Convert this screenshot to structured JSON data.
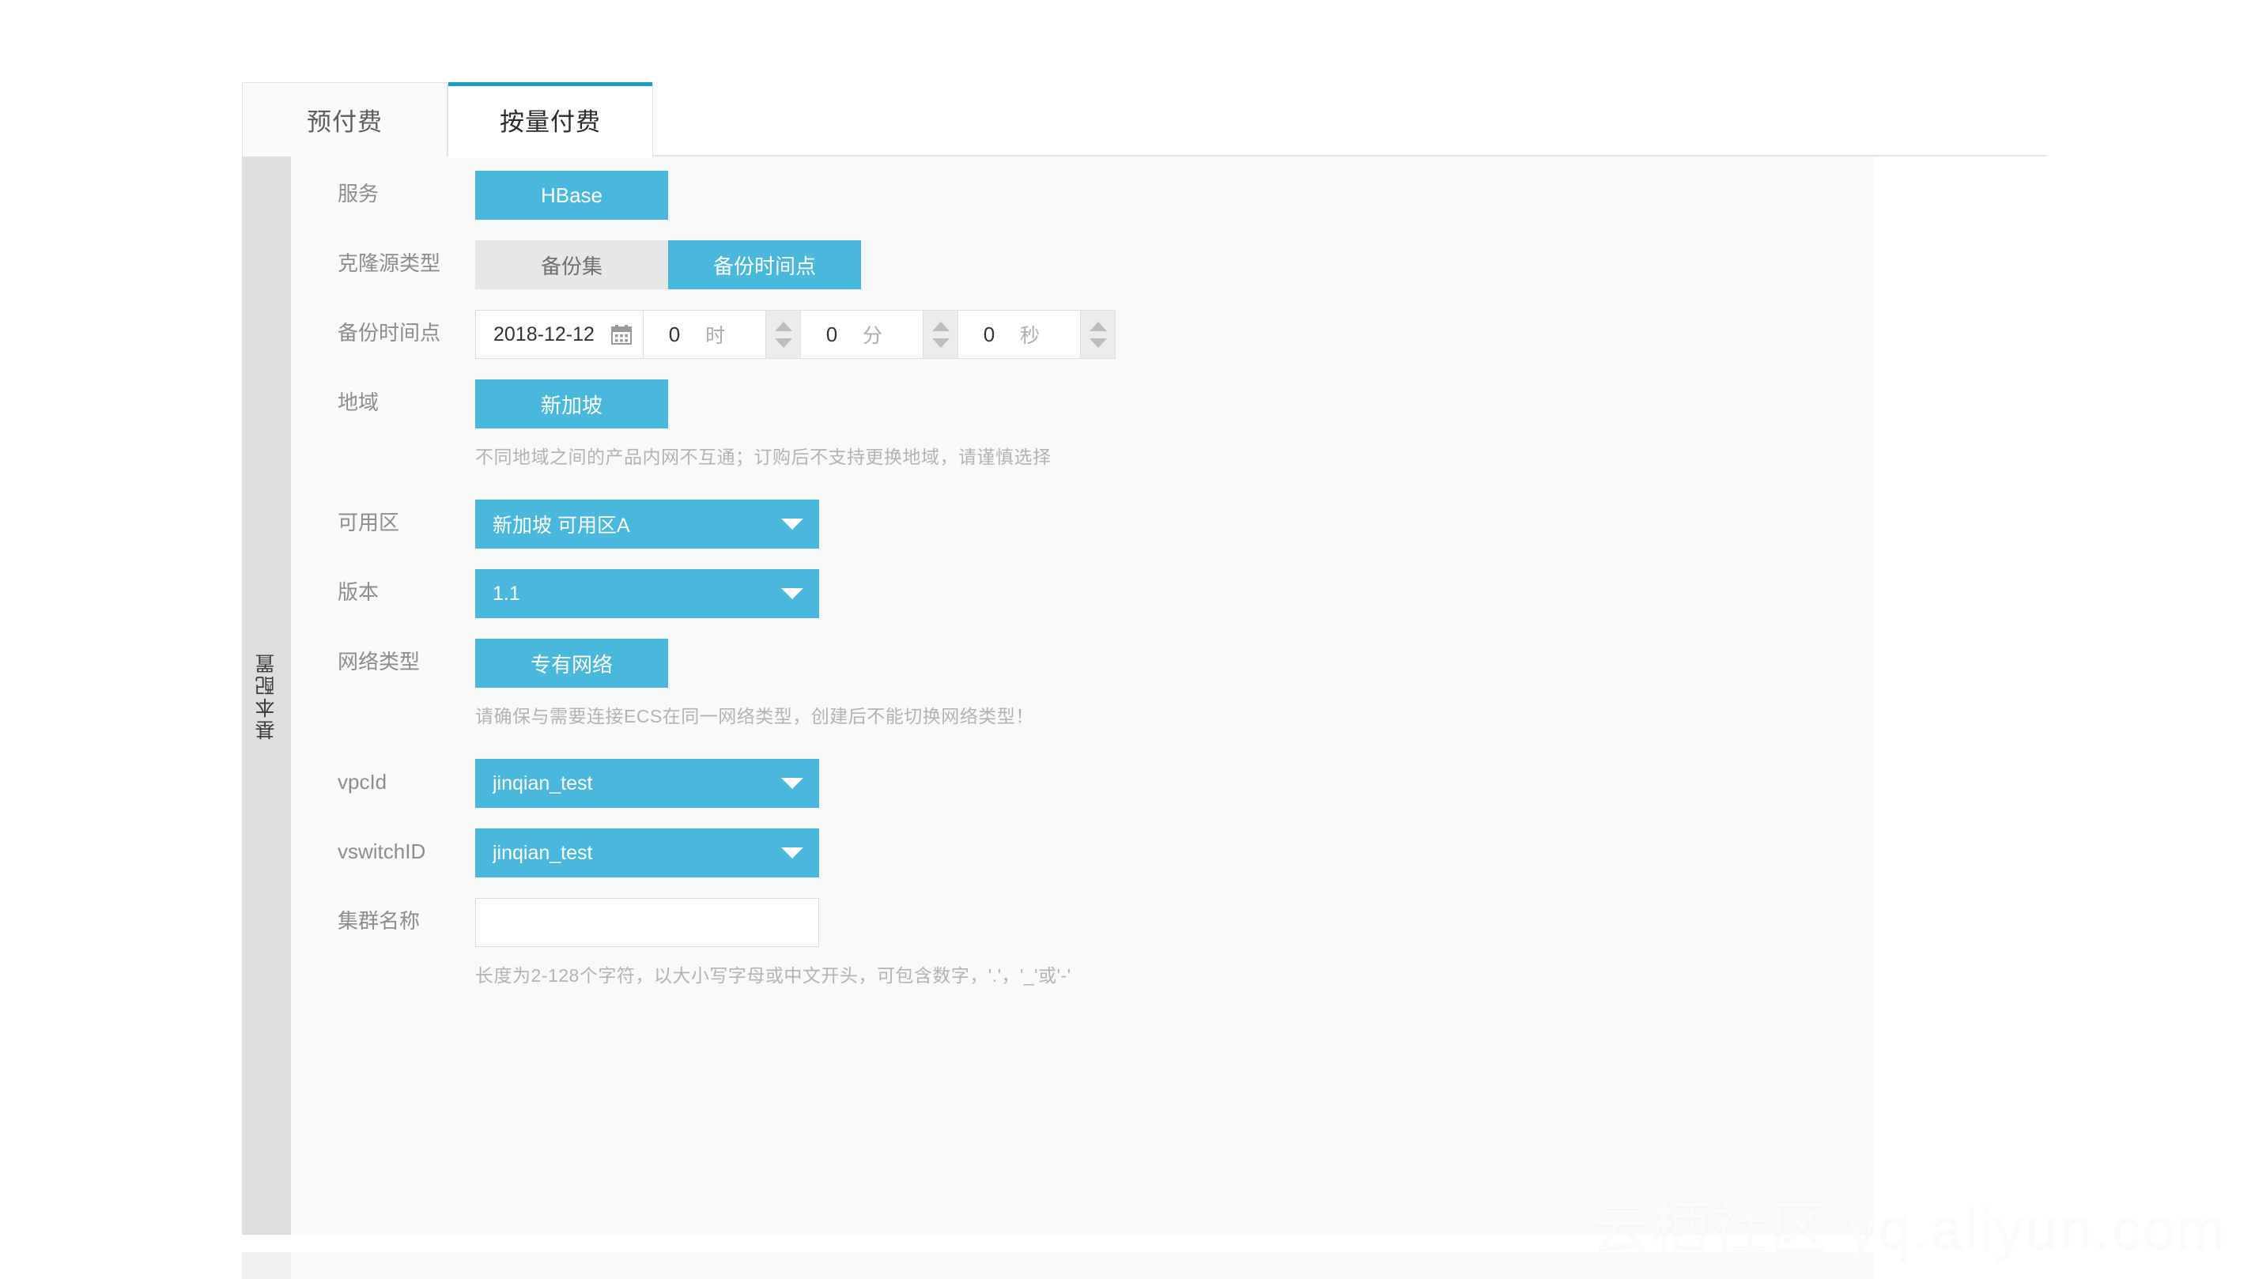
{
  "tabs": [
    {
      "label": "预付费",
      "active": false
    },
    {
      "label": "按量付费",
      "active": true
    }
  ],
  "section": {
    "rail_label": "基本配置"
  },
  "form": {
    "service": {
      "label": "服务",
      "value": "HBase"
    },
    "clone_source_type": {
      "label": "克隆源类型",
      "options": [
        {
          "label": "备份集",
          "selected": false
        },
        {
          "label": "备份时间点",
          "selected": true
        }
      ]
    },
    "backup_time": {
      "label": "备份时间点",
      "date": "2018-12-12",
      "hour": {
        "value": "0",
        "unit": "时"
      },
      "minute": {
        "value": "0",
        "unit": "分"
      },
      "second": {
        "value": "0",
        "unit": "秒"
      },
      "calendar_icon": "calendar-icon"
    },
    "region": {
      "label": "地域",
      "value": "新加坡",
      "hint": "不同地域之间的产品内网不互通；订购后不支持更换地域，请谨慎选择"
    },
    "zone": {
      "label": "可用区",
      "value": "新加坡 可用区A"
    },
    "version": {
      "label": "版本",
      "value": "1.1"
    },
    "network_type": {
      "label": "网络类型",
      "value": "专有网络",
      "hint": "请确保与需要连接ECS在同一网络类型，创建后不能切换网络类型！"
    },
    "vpc_id": {
      "label": "vpcId",
      "value": "jinqian_test"
    },
    "vswitch_id": {
      "label": "vswitchID",
      "value": "jinqian_test"
    },
    "cluster_name": {
      "label": "集群名称",
      "value": "",
      "placeholder": "",
      "hint": "长度为2-128个字符，以大小写字母或中文开头，可包含数字，'.'，'_'或'-'"
    }
  },
  "watermark": "云栖社区 yq.aliyun.com",
  "colors": {
    "accent": "#4ab8dc",
    "tab_active_bar": "#1c9cc4",
    "panel_bg": "#f9f9f9",
    "rail_bg": "#dedede",
    "segment_off": "#e7e7e7",
    "label_text": "#8d8d8d",
    "hint_text": "#b3b3b3"
  }
}
